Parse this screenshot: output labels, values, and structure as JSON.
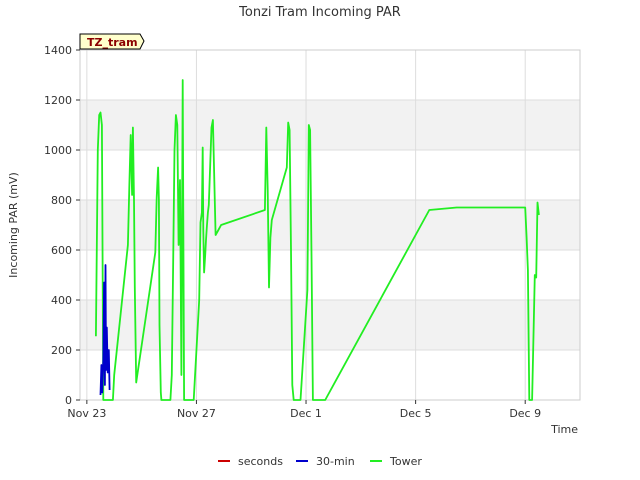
{
  "chart_data": {
    "type": "line",
    "title": "Tonzi Tram Incoming PAR",
    "xlabel": "Time",
    "ylabel": "Incoming PAR (mV)",
    "ylim": [
      0,
      1400
    ],
    "yticks": [
      0,
      200,
      400,
      600,
      800,
      1000,
      1200,
      1400
    ],
    "xlim_days": [
      22.75,
      31.3
    ],
    "xticks": [
      {
        "label": "Nov 23",
        "day": 23
      },
      {
        "label": "Nov 27",
        "day": 27
      },
      {
        "label": "Dec 1",
        "day": 31
      },
      {
        "label": "Dec 5",
        "day": 35
      },
      {
        "label": "Dec 9",
        "day": 39
      }
    ],
    "xdomain": [
      22.75,
      41.0
    ],
    "grid": true,
    "site_tag": "TZ_tram",
    "colors": {
      "seconds": "#cc0000",
      "30-min": "#0000cc",
      "Tower": "#22ee22",
      "band": "#f2f2f2",
      "grid": "#dddddd",
      "tag_bg": "#ffffcc"
    },
    "legend_position": "bottom",
    "series": [
      {
        "name": "seconds",
        "x": [],
        "y": []
      },
      {
        "name": "30-min",
        "x": [
          23.5,
          23.53,
          23.56,
          23.6,
          23.63,
          23.66,
          23.68,
          23.7,
          23.73,
          23.76,
          23.8,
          23.83
        ],
        "y": [
          20,
          140,
          30,
          160,
          470,
          60,
          540,
          120,
          290,
          110,
          200,
          40
        ]
      },
      {
        "name": "Tower",
        "x": [
          23.33,
          23.4,
          23.45,
          23.5,
          23.55,
          23.6,
          23.68,
          23.75,
          23.85,
          23.95,
          24.0,
          24.5,
          24.55,
          24.6,
          24.65,
          24.68,
          24.72,
          24.75,
          24.8,
          25.5,
          25.55,
          25.6,
          25.63,
          25.65,
          25.7,
          25.72,
          25.75,
          26.05,
          26.1,
          26.15,
          26.2,
          26.25,
          26.3,
          26.35,
          26.4,
          26.45,
          26.5,
          26.55,
          26.6,
          26.65,
          26.9,
          27.1,
          27.15,
          27.2,
          27.23,
          27.25,
          27.28,
          27.32,
          27.35,
          27.38,
          27.42,
          27.45,
          27.55,
          27.6,
          27.7,
          27.8,
          27.9,
          29.5,
          29.55,
          29.6,
          29.65,
          29.7,
          29.75,
          30.3,
          30.35,
          30.4,
          30.45,
          30.5,
          30.55,
          30.6,
          30.65,
          30.8,
          31.05,
          31.1,
          31.15,
          31.2,
          31.25,
          31.35,
          31.6,
          31.7,
          35.5,
          36.5,
          39.0,
          39.05,
          39.1,
          39.15,
          39.2,
          39.25,
          39.35,
          39.4,
          39.45,
          39.5
        ],
        "y": [
          255,
          1000,
          1140,
          1150,
          1100,
          0,
          0,
          0,
          0,
          0,
          100,
          620,
          850,
          1060,
          820,
          1090,
          800,
          450,
          70,
          590,
          810,
          930,
          800,
          300,
          30,
          0,
          0,
          0,
          100,
          560,
          1000,
          1140,
          1100,
          620,
          880,
          100,
          1280,
          0,
          0,
          0,
          0,
          400,
          710,
          750,
          1010,
          680,
          510,
          580,
          640,
          690,
          750,
          780,
          1090,
          1120,
          660,
          680,
          700,
          760,
          1090,
          840,
          450,
          650,
          720,
          930,
          1110,
          1080,
          600,
          60,
          0,
          0,
          0,
          0,
          440,
          1100,
          1080,
          580,
          0,
          0,
          0,
          0,
          760,
          770,
          770,
          650,
          520,
          0,
          0,
          0,
          500,
          490,
          790,
          740
        ]
      }
    ]
  },
  "legend": [
    {
      "label": "seconds",
      "color": "#cc0000"
    },
    {
      "label": "30-min",
      "color": "#0000cc"
    },
    {
      "label": "Tower",
      "color": "#22ee22"
    }
  ]
}
